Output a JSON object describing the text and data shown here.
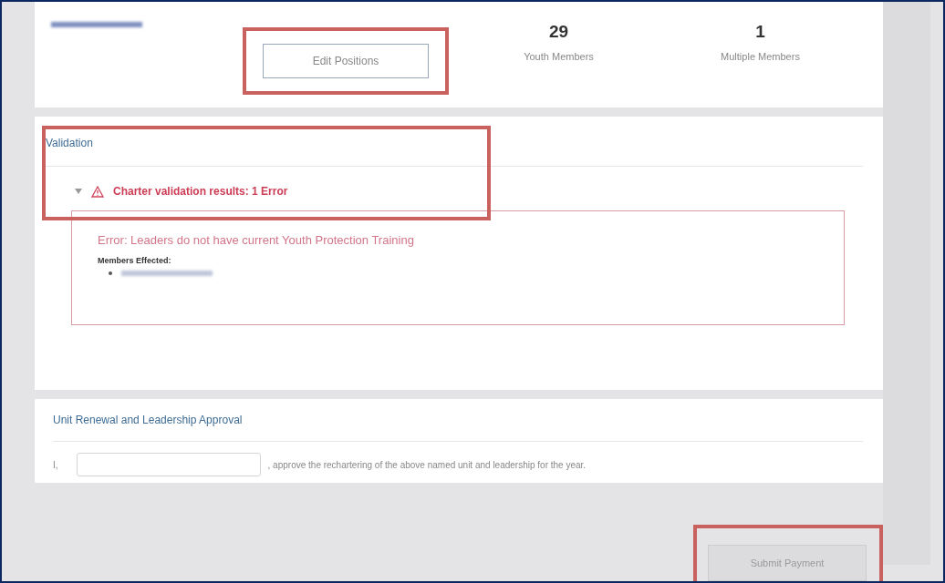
{
  "positions": {
    "edit_button": "Edit Positions"
  },
  "stats": [
    {
      "value": "29",
      "label": "Youth Members"
    },
    {
      "value": "1",
      "label": "Multiple Members"
    }
  ],
  "validation": {
    "title": "Validation",
    "expanded": true,
    "summary": "Charter validation results: 1 Error",
    "error_title": "Error: Leaders do not have current Youth Protection Training",
    "members_label": "Members Effected:"
  },
  "approval": {
    "title": "Unit Renewal and Leadership Approval",
    "prefix": "I,",
    "statement": ", approve the rechartering of the above named unit and leadership for the year."
  },
  "submit": {
    "label": "Submit Payment",
    "disabled": true
  }
}
